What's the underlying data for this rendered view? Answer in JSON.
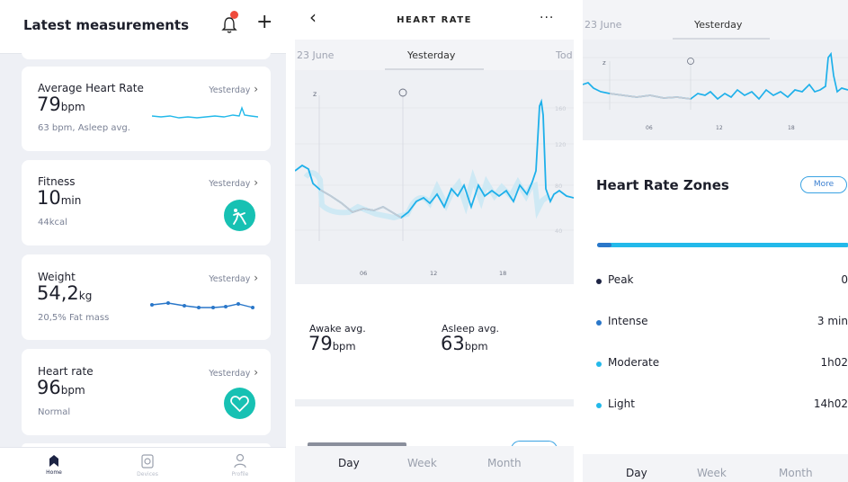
{
  "panel1": {
    "title": "Latest measurements",
    "cards": [
      {
        "title": "Average Heart Rate",
        "date": "Yesterday",
        "value": "79",
        "unit": "bpm",
        "sub": "63 bpm, Asleep avg."
      },
      {
        "title": "Fitness",
        "date": "Yesterday",
        "value": "10",
        "unit": "min",
        "sub": "44kcal"
      },
      {
        "title": "Weight",
        "date": "Yesterday",
        "value": "54,2",
        "unit": "kg",
        "sub": "20,5% Fat mass"
      },
      {
        "title": "Heart rate",
        "date": "Yesterday",
        "value": "96",
        "unit": "bpm",
        "sub": "Normal"
      }
    ],
    "tabs": [
      {
        "label": "Home"
      },
      {
        "label": "Devices"
      },
      {
        "label": "Profile"
      }
    ]
  },
  "panel2": {
    "title": "HEART RATE",
    "dates": {
      "prev": "23 June",
      "current": "Yesterday",
      "next": "Tod"
    },
    "chart_labels": {
      "y": [
        "160",
        "120",
        "80",
        "40"
      ],
      "x": [
        "06",
        "12",
        "18"
      ]
    },
    "awake": {
      "label": "Awake avg.",
      "value": "79",
      "unit": "bpm"
    },
    "asleep": {
      "label": "Asleep avg.",
      "value": "63",
      "unit": "bpm"
    },
    "periods": [
      "Day",
      "Week",
      "Month"
    ]
  },
  "panel3": {
    "dates": {
      "prev": "23 June",
      "current": "Yesterday"
    },
    "chart_labels": {
      "x": [
        "06",
        "12",
        "18"
      ]
    },
    "zones_title": "Heart Rate Zones",
    "more_label": "More",
    "zones": [
      {
        "name": "Peak",
        "value": "0",
        "color": "#1d2444"
      },
      {
        "name": "Intense",
        "value": "3 min",
        "color": "#2a77c9"
      },
      {
        "name": "Moderate",
        "value": "1h02",
        "color": "#23b9ea"
      },
      {
        "name": "Light",
        "value": "14h02",
        "color": "#23b9ea"
      }
    ],
    "periods": [
      "Day",
      "Week",
      "Month"
    ]
  },
  "colors": {
    "accent": "#23b9ea",
    "teal": "#17c1b3",
    "notification": "#ef4b3c",
    "dark": "#1d2444"
  }
}
